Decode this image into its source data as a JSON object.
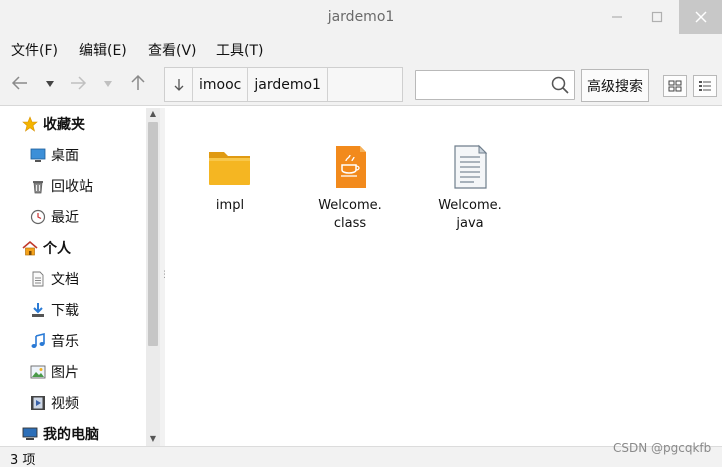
{
  "window": {
    "title": "jardemo1"
  },
  "menu": [
    {
      "label": "文件(F)"
    },
    {
      "label": "编辑(E)"
    },
    {
      "label": "查看(V)"
    },
    {
      "label": "工具(T)"
    }
  ],
  "toolbar": {
    "breadcrumb": [
      "imooc",
      "jardemo1"
    ],
    "search_value": "",
    "advanced_search_label": "高级搜索"
  },
  "sidebar": {
    "favorites_label": "收藏夹",
    "favorites": [
      {
        "label": "桌面",
        "icon": "desktop-icon"
      },
      {
        "label": "回收站",
        "icon": "trash-icon"
      },
      {
        "label": "最近",
        "icon": "clock-icon"
      }
    ],
    "personal_label": "个人",
    "personal": [
      {
        "label": "文档",
        "icon": "document-icon"
      },
      {
        "label": "下载",
        "icon": "download-icon"
      },
      {
        "label": "音乐",
        "icon": "music-icon"
      },
      {
        "label": "图片",
        "icon": "picture-icon"
      },
      {
        "label": "视频",
        "icon": "video-icon"
      }
    ],
    "computer_label": "我的电脑"
  },
  "files": [
    {
      "name_line1": "impl",
      "name_line2": "",
      "icon": "folder-icon"
    },
    {
      "name_line1": "Welcome.",
      "name_line2": "class",
      "icon": "java-class-icon"
    },
    {
      "name_line1": "Welcome.",
      "name_line2": "java",
      "icon": "text-file-icon"
    }
  ],
  "status": {
    "text": "3 项"
  },
  "watermark": "CSDN @pgcqkfb",
  "colors": {
    "chrome": "#f2f2f2",
    "folder": "#f5b622",
    "java": "#f28a1c"
  }
}
